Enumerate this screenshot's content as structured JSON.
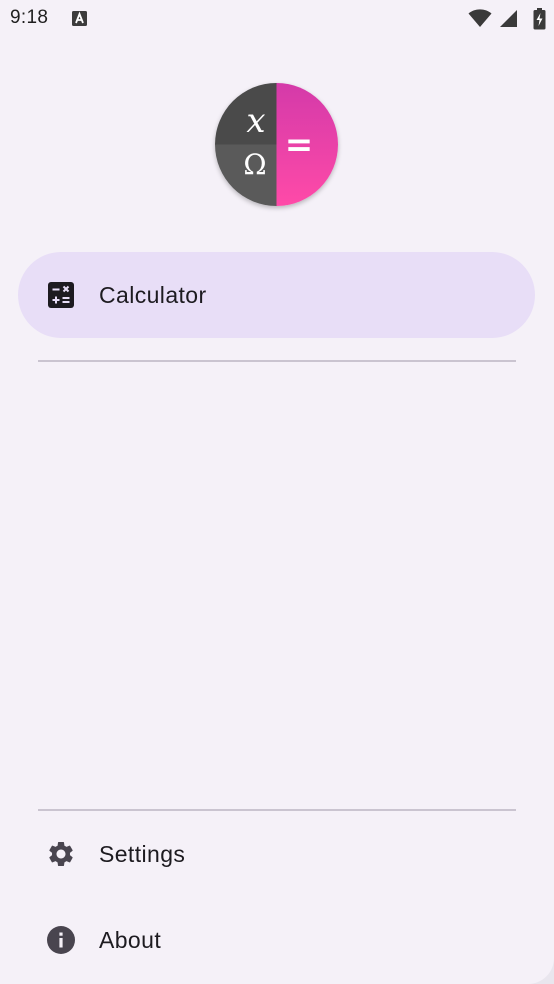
{
  "status_bar": {
    "time": "9:18",
    "notification_icon": "a-notification-icon",
    "wifi_icon": "wifi-icon",
    "signal_icon": "cell-signal-icon",
    "battery_icon": "battery-charging-icon"
  },
  "app_logo": {
    "symbol_x": "x",
    "symbol_omega": "Ω",
    "symbol_equals": "=",
    "colors": {
      "dark": "#4a4a4a",
      "mid": "#5a5a5a",
      "accent_top": "#d43aa9",
      "accent_bottom": "#ff4aa8"
    }
  },
  "drawer": {
    "items": [
      {
        "label": "Calculator",
        "icon": "calculator-icon",
        "active": true
      }
    ],
    "bottom_items": [
      {
        "label": "Settings",
        "icon": "gear-icon"
      },
      {
        "label": "About",
        "icon": "info-icon"
      }
    ]
  },
  "colors": {
    "background": "#f5f1f8",
    "active_item": "#e8def7",
    "divider": "#cac4d0",
    "text": "#1d1b20",
    "icon": "#49454f"
  }
}
